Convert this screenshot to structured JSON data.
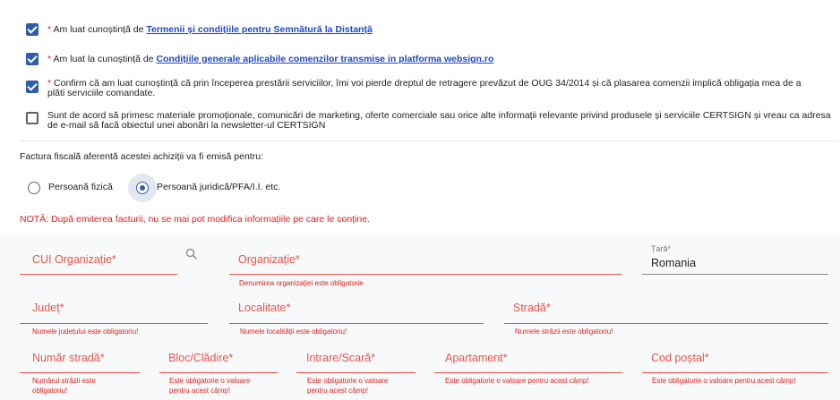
{
  "agreements": [
    {
      "checked": true,
      "required_mark": "*",
      "text": "Am luat cunoștință  de",
      "link": "Termenii și condițiile pentru Semnătură la Distanță"
    },
    {
      "checked": true,
      "required_mark": "*",
      "text": "Am luat la cunoștință  de",
      "link": "Condițiile generale aplicabile comenzilor transmise in platforma websign.ro"
    },
    {
      "checked": true,
      "required_mark": "*",
      "text": "Confirm că am luat cunoștință că prin începerea prestării serviciilor,  îmi voi pierde dreptul de retragere prevăzut de OUG 34/2014 și că plasarea comenzii implică obligația mea de a plăti serviciile comandate."
    },
    {
      "checked": false,
      "text": "Sunt de acord să primesc materiale promoționale, comunicări de marketing, oferte comerciale sau orice alte informații relevante privind produsele și serviciile CERTSIGN și vreau ca adresa de e-mail să facă obiectul unei abonări la newsletter-ul CERTSIGN"
    }
  ],
  "invoice": {
    "question": "Factura fiscală aferentă acestei achiziții va fi emisă pentru:",
    "options": [
      {
        "label": "Persoană fizică",
        "selected": false
      },
      {
        "label": "Persoană juridică/PFA/I.I. etc.",
        "selected": true
      }
    ],
    "note": "NOTĂ: După emiterea facturii, nu se mai pot modifica informațiile pe care le conține."
  },
  "fields": {
    "cui": {
      "label": "CUI Organizație*",
      "icon": "search-icon"
    },
    "organizatie": {
      "label": "Organizație*",
      "error": "Denumirea organizației este obligatorie"
    },
    "tara": {
      "label": "Țară*",
      "value": "Romania"
    },
    "judet": {
      "label": "Județ*",
      "error": "Numele județului este obligatoriu!"
    },
    "localitate": {
      "label": "Localitate*",
      "error": "Numele localității este obligatoriu!"
    },
    "strada": {
      "label": "Stradă*",
      "error": "Numele străzii este obligatoriu!"
    },
    "numar": {
      "label": "Număr stradă*",
      "error": "Numărul străzii este obligatoriu!"
    },
    "bloc": {
      "label": "Bloc/Clădire*",
      "error": "Este obligatorie o valoare pentru acest câmp!"
    },
    "intrare": {
      "label": "Intrare/Scară*",
      "error": "Este obligatorie o valoare pentru acest câmp!"
    },
    "apartament": {
      "label": "Apartament*",
      "error": "Este obligatorie o valoare pentru acest câmp!"
    },
    "cod_postal": {
      "label": "Cod poștal*",
      "error": "Este obligatorie o valoare pentru acest câmp!"
    }
  },
  "colors": {
    "error": "#ed5347",
    "accent": "#2f5dab",
    "link": "#1f49c4"
  }
}
